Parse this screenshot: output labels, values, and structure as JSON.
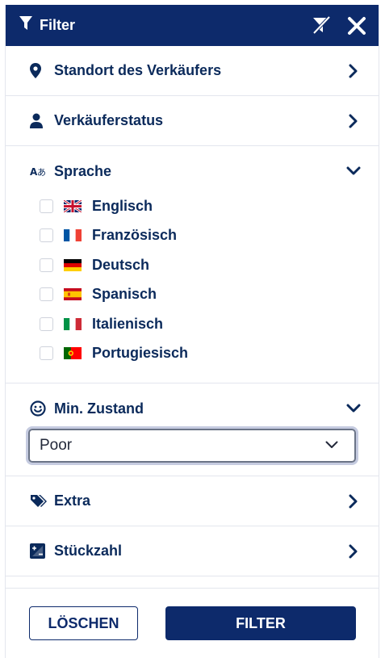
{
  "header": {
    "title": "Filter",
    "clear_filters_icon": "filter-clear-icon",
    "close_icon": "close-icon"
  },
  "sections": {
    "location": {
      "label": "Standort des Verkäufers",
      "icon": "location-pin-icon",
      "state": "collapsed"
    },
    "seller_status": {
      "label": "Verkäuferstatus",
      "icon": "user-icon",
      "state": "collapsed"
    },
    "language": {
      "label": "Sprache",
      "icon": "translate-icon",
      "state": "expanded",
      "options": [
        {
          "label": "Englisch",
          "flag": "gb",
          "checked": false
        },
        {
          "label": "Französisch",
          "flag": "fr",
          "checked": false
        },
        {
          "label": "Deutsch",
          "flag": "de",
          "checked": false
        },
        {
          "label": "Spanisch",
          "flag": "es",
          "checked": false
        },
        {
          "label": "Italienisch",
          "flag": "it",
          "checked": false
        },
        {
          "label": "Portugiesisch",
          "flag": "pt",
          "checked": false
        }
      ]
    },
    "condition": {
      "label": "Min. Zustand",
      "icon": "smiley-icon",
      "state": "expanded",
      "selected": "Poor"
    },
    "extra": {
      "label": "Extra",
      "icon": "tags-icon",
      "state": "collapsed"
    },
    "quantity": {
      "label": "Stückzahl",
      "icon": "quantity-icon",
      "state": "collapsed"
    }
  },
  "footer": {
    "clear_label": "LÖSCHEN",
    "filter_label": "FILTER"
  },
  "colors": {
    "primary": "#0d2a6b",
    "border": "#e3e6ee"
  }
}
